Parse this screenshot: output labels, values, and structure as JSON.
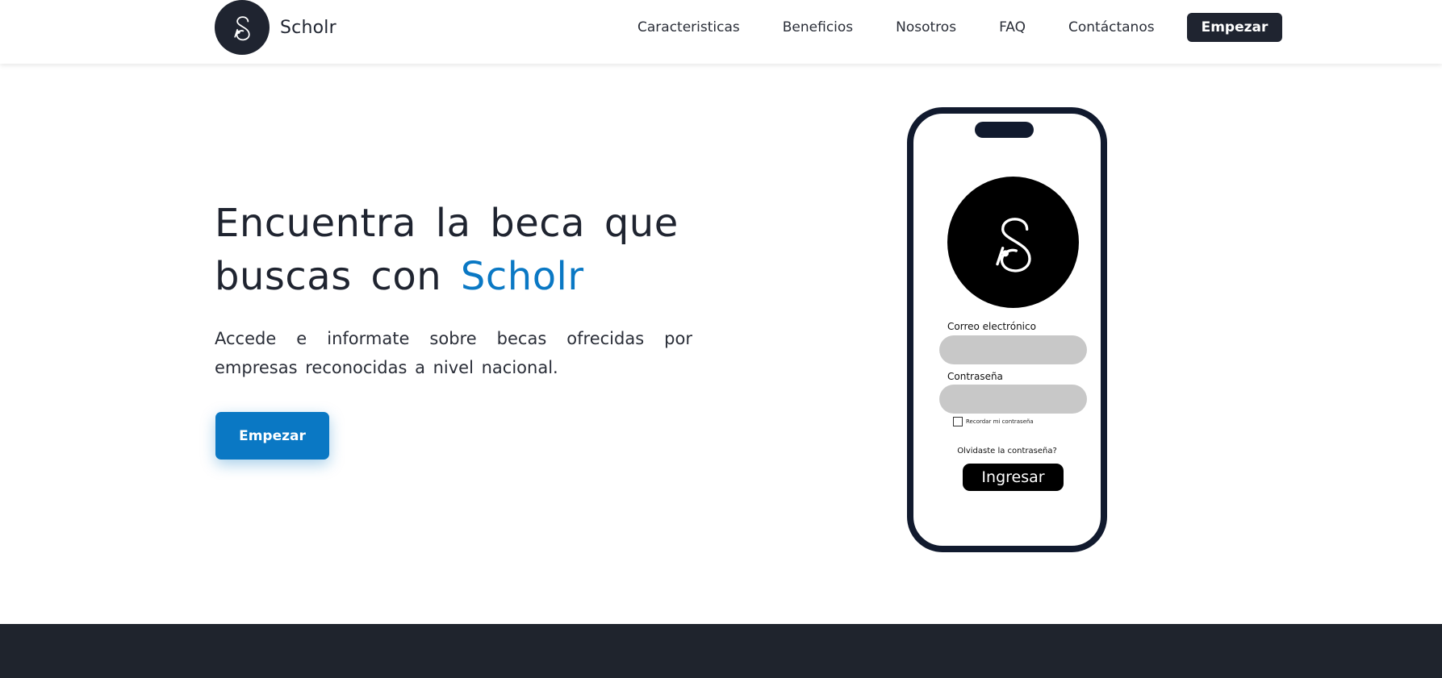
{
  "brand": {
    "name": "Scholr",
    "logo_icon": "scholr-monogram-icon"
  },
  "nav": {
    "items": [
      {
        "label": "Caracteristicas"
      },
      {
        "label": "Beneficios"
      },
      {
        "label": "Nosotros"
      },
      {
        "label": "FAQ"
      },
      {
        "label": "Contáctanos"
      }
    ],
    "cta_label": "Empezar"
  },
  "hero": {
    "title_line1": "Encuentra la beca que",
    "title_line2_prefix": "buscas con ",
    "title_accent": "Scholr",
    "subtitle": "Accede e informate sobre becas ofrecidas por empresas reconocidas a nivel nacional.",
    "cta_label": "Empezar"
  },
  "phone": {
    "email_label": "Correo electrónico",
    "password_label": "Contraseña",
    "remember_label": "Recordar mi contraseña",
    "forgot_label": "Olvidaste la contraseña?",
    "login_label": "Ingresar"
  },
  "colors": {
    "dark": "#1f2430",
    "accent": "#0a78c4",
    "phone_frame": "#111a2e",
    "input_fill": "#c8c8c8",
    "footer_band": "#1f242d"
  }
}
